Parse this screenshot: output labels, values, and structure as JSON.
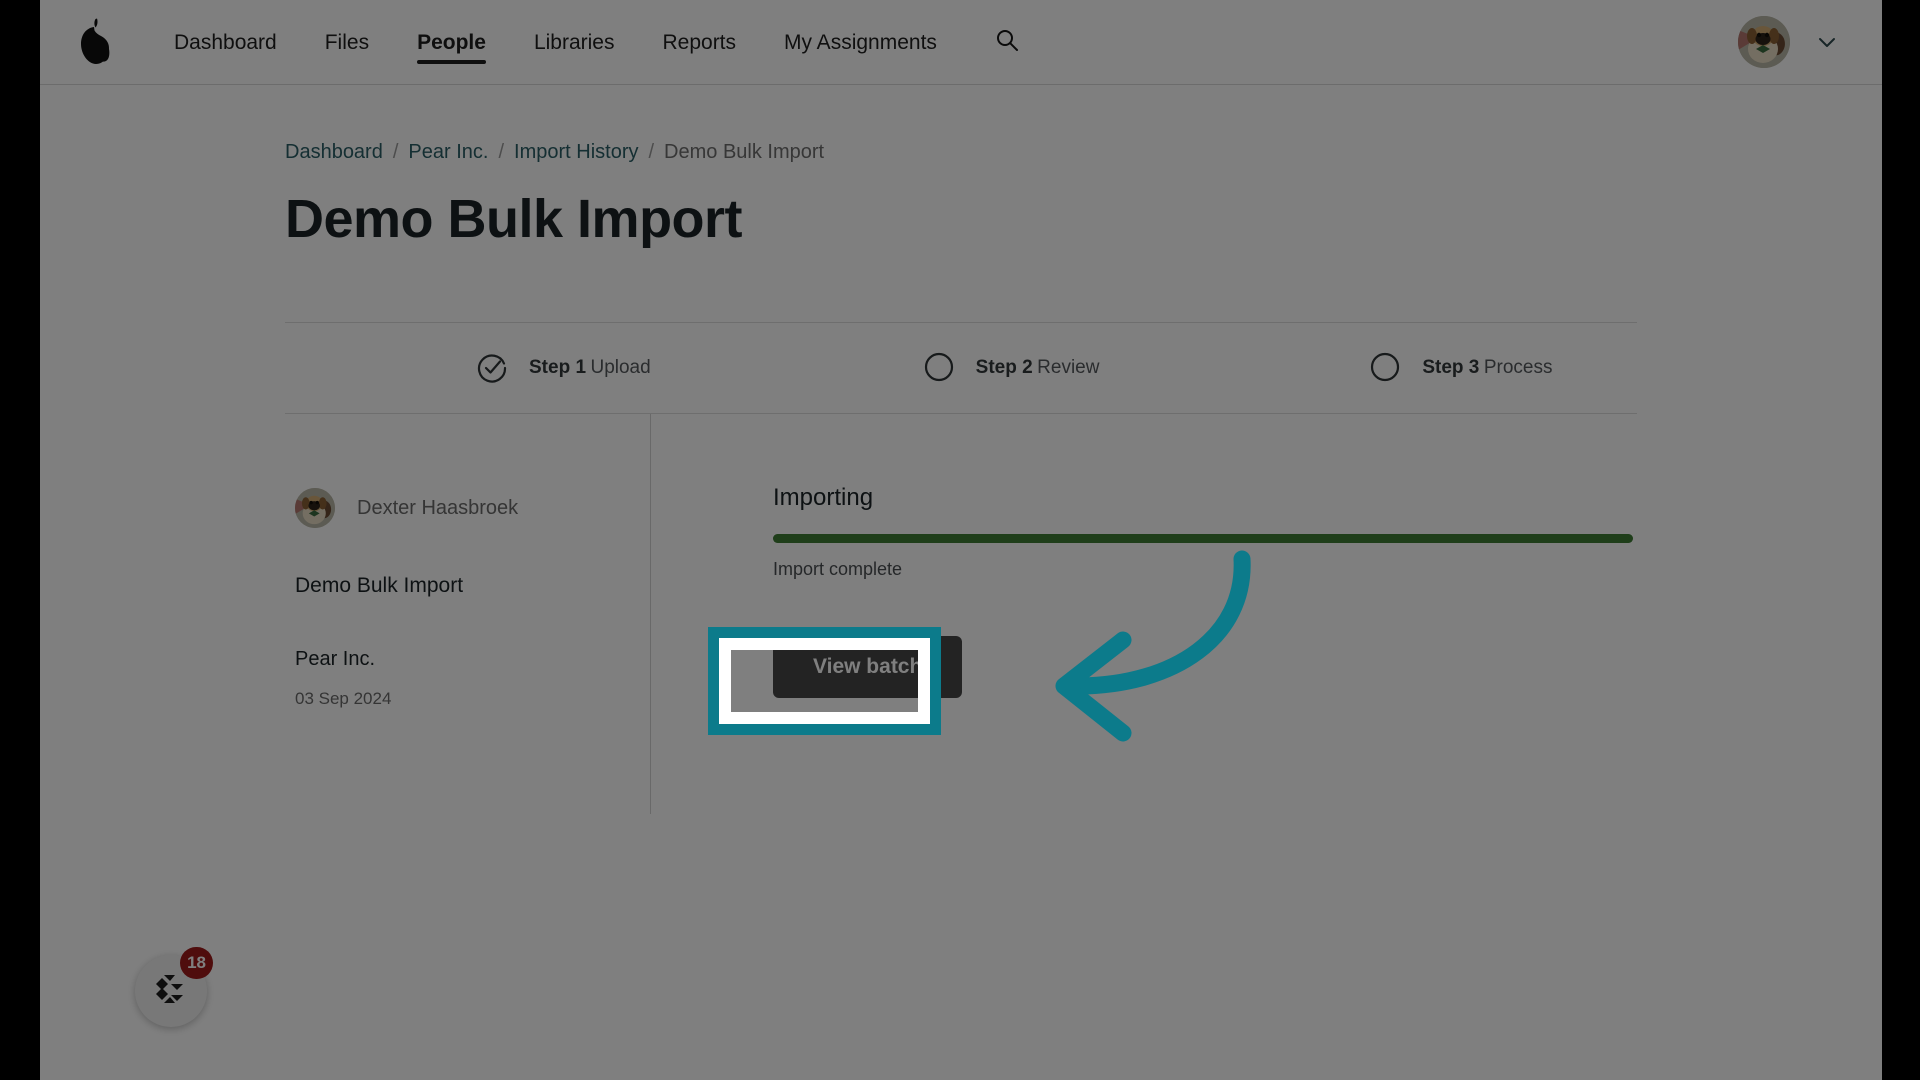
{
  "brand": {
    "logo_icon": "pear-logo-icon",
    "accent_teal": "#0c7b8b",
    "progress_green": "#3f7d35",
    "button_gray": "#464646",
    "badge_red": "#9e1b1b"
  },
  "nav": {
    "items": [
      {
        "label": "Dashboard",
        "active": false
      },
      {
        "label": "Files",
        "active": false
      },
      {
        "label": "People",
        "active": true
      },
      {
        "label": "Libraries",
        "active": false
      },
      {
        "label": "Reports",
        "active": false
      },
      {
        "label": "My Assignments",
        "active": false
      }
    ],
    "search_icon": "search-icon",
    "account_chevron_icon": "chevron-down-icon",
    "avatar_icon": "user-avatar-dog-photo"
  },
  "breadcrumb": {
    "items": [
      {
        "label": "Dashboard",
        "current": false
      },
      {
        "label": "Pear Inc.",
        "current": false
      },
      {
        "label": "Import History",
        "current": false
      },
      {
        "label": "Demo Bulk Import",
        "current": true
      }
    ],
    "separator": "/"
  },
  "page": {
    "title": "Demo Bulk Import"
  },
  "stepper": {
    "steps": [
      {
        "name": "Step 1",
        "sub": "Upload",
        "state": "complete",
        "icon": "check-circle-icon"
      },
      {
        "name": "Step 2",
        "sub": "Review",
        "state": "pending",
        "icon": "empty-circle-icon"
      },
      {
        "name": "Step 3",
        "sub": "Process",
        "state": "pending",
        "icon": "empty-circle-icon"
      }
    ]
  },
  "details": {
    "owner_name": "Dexter Haasbroek",
    "batch_name": "Demo Bulk Import",
    "organization": "Pear Inc.",
    "date": "03 Sep 2024"
  },
  "import_status": {
    "heading": "Importing",
    "progress_percent": 100,
    "caption": "Import complete",
    "view_batch_label": "View batch"
  },
  "annotation": {
    "highlight_target": "view-batch-button",
    "arrow_icon": "curved-arrow-left-icon"
  },
  "help_widget": {
    "icon": "help-widget-icon",
    "badge_count": "18"
  }
}
